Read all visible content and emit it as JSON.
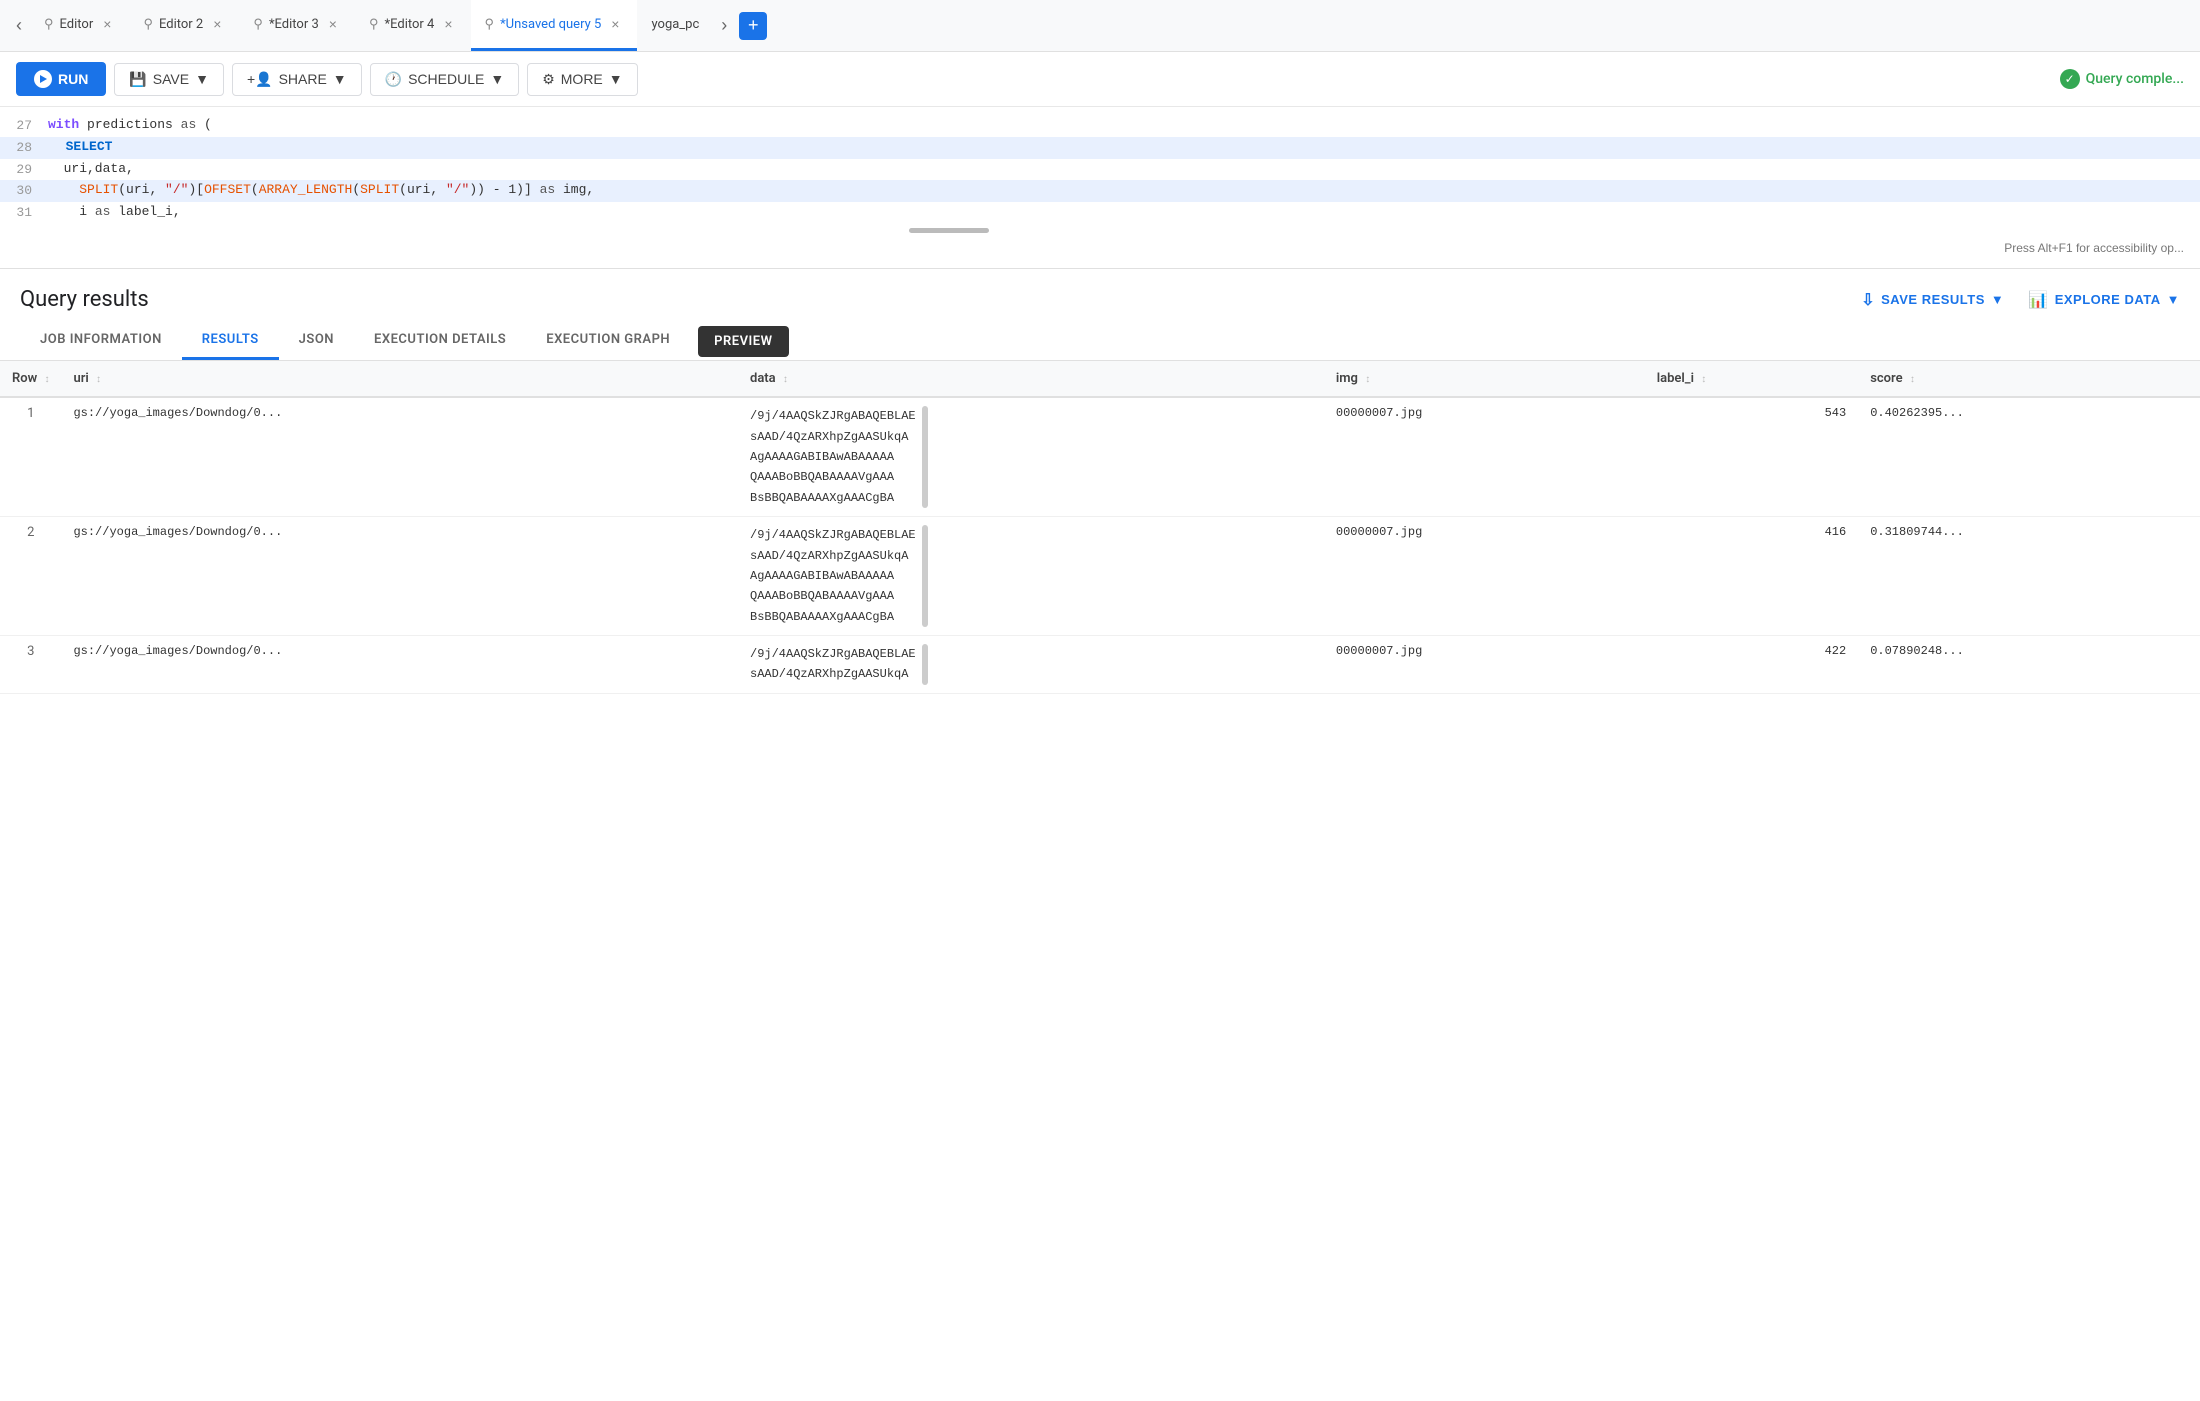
{
  "tabs": [
    {
      "id": "editor1",
      "label": "Editor",
      "active": false,
      "unsaved": false
    },
    {
      "id": "editor2",
      "label": "Editor 2",
      "active": false,
      "unsaved": false
    },
    {
      "id": "editor3",
      "label": "*Editor 3",
      "active": false,
      "unsaved": true
    },
    {
      "id": "editor4",
      "label": "*Editor 4",
      "active": false,
      "unsaved": true
    },
    {
      "id": "unsaved5",
      "label": "*Unsaved query 5",
      "active": true,
      "unsaved": true
    },
    {
      "id": "yoga_pc",
      "label": "yoga_pc",
      "active": false,
      "unsaved": false
    }
  ],
  "toolbar": {
    "run_label": "RUN",
    "save_label": "SAVE",
    "share_label": "SHARE",
    "schedule_label": "SCHEDULE",
    "more_label": "MORE",
    "status_text": "Query comple..."
  },
  "code": {
    "lines": [
      {
        "num": "27",
        "text": "with predictions as (",
        "highlight": false
      },
      {
        "num": "28",
        "text": "  SELECT",
        "highlight": true
      },
      {
        "num": "29",
        "text": "  uri,data,",
        "highlight": false
      },
      {
        "num": "30",
        "text": "    SPLIT(uri, \"/\")[OFFSET(ARRAY_LENGTH(SPLIT(uri, \"/\")) - 1)] as img,",
        "highlight": true
      },
      {
        "num": "31",
        "text": "    i as label_i,",
        "highlight": false
      }
    ]
  },
  "a11y_hint": "Press Alt+F1 for accessibility op...",
  "results": {
    "title": "Query results",
    "save_results_label": "SAVE RESULTS",
    "explore_data_label": "EXPLORE DATA"
  },
  "sub_tabs": [
    {
      "id": "job_info",
      "label": "JOB INFORMATION",
      "active": false
    },
    {
      "id": "results",
      "label": "RESULTS",
      "active": true
    },
    {
      "id": "json",
      "label": "JSON",
      "active": false
    },
    {
      "id": "exec_details",
      "label": "EXECUTION DETAILS",
      "active": false
    },
    {
      "id": "exec_graph",
      "label": "EXECUTION GRAPH",
      "active": false
    },
    {
      "id": "preview",
      "label": "PREVIEW",
      "active": false,
      "style": "pill"
    }
  ],
  "table": {
    "columns": [
      "Row",
      "uri",
      "data",
      "img",
      "label_i",
      "score"
    ],
    "rows": [
      {
        "row": "1",
        "uri": "gs://yoga_images/Downdog/0...",
        "data": "/9j/4AAQSkZJRgABAQEBLAE\nsAAD/4QzARXhpZgAASUkqA\nAgAAAAGABIBAwABAAAAA\nQAAABoBBQABAAAAVgAAA\nBsBBQABAAAAXgAAACgBA",
        "img": "00000007.jpg",
        "label_i": "543",
        "score": "0.40262395..."
      },
      {
        "row": "2",
        "uri": "gs://yoga_images/Downdog/0...",
        "data": "/9j/4AAQSkZJRgABAQEBLAE\nsAAD/4QzARXhpZgAASUkqA\nAgAAAAGABIBAwABAAAAA\nQAAABoBBQABAAAAVgAAA\nBsBBQABAAAAXgAAACgBA",
        "img": "00000007.jpg",
        "label_i": "416",
        "score": "0.31809744..."
      },
      {
        "row": "3",
        "uri": "gs://yoga_images/Downdog/0...",
        "data": "/9j/4AAQSkZJRgABAQEBLAE\nsAAD/4QzARXhpZgAASUkqA",
        "img": "00000007.jpg",
        "label_i": "422",
        "score": "0.07890248..."
      }
    ]
  }
}
